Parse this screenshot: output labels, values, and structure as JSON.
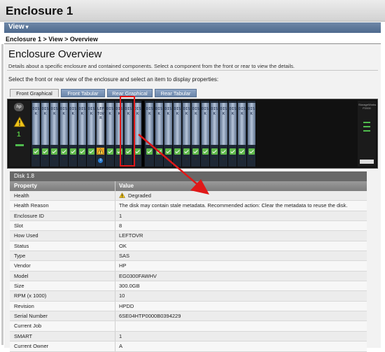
{
  "window": {
    "title": "Enclosure 1"
  },
  "menu": {
    "view_label": "View"
  },
  "breadcrumb": "Enclosure 1 > View > Overview",
  "page": {
    "heading": "Enclosure Overview",
    "description": "Details about a specific enclosure and contained components. Select a component from the front or rear to view the details.",
    "instruction": "Select the front or rear view of the enclosure and select an item to display properties:"
  },
  "tabs": [
    {
      "label": "Front Graphical",
      "active": true
    },
    {
      "label": "Front Tabular",
      "active": false
    },
    {
      "label": "Rear Graphical",
      "active": false
    },
    {
      "label": "Rear Tabular",
      "active": false
    }
  ],
  "enclosure": {
    "logo": "hp",
    "status_number": "1",
    "drive_label": "DISK",
    "selected_drive_label": "LEFTOVR",
    "right_brand": "StorageWorks P2000",
    "colors": {
      "drive_face": "#b6c5da",
      "ok_check": "#5fb84a",
      "warning": "#f0c419",
      "selection": "#e01818"
    }
  },
  "disk_panel": {
    "header": "Disk 1.8",
    "columns": [
      "Property",
      "Value"
    ],
    "rows": [
      {
        "property": "Health",
        "value": "Degraded",
        "icon": "warning-icon"
      },
      {
        "property": "Health Reason",
        "value": "The disk may contain stale metadata. Recommended action: Clear the metadata to reuse the disk."
      },
      {
        "property": "Enclosure ID",
        "value": "1"
      },
      {
        "property": "Slot",
        "value": "8"
      },
      {
        "property": "How Used",
        "value": "LEFTOVR"
      },
      {
        "property": "Status",
        "value": "OK"
      },
      {
        "property": "Type",
        "value": "SAS"
      },
      {
        "property": "Vendor",
        "value": "HP"
      },
      {
        "property": "Model",
        "value": "EG0300FAWHV"
      },
      {
        "property": "Size",
        "value": "300.0GB"
      },
      {
        "property": "RPM (x 1000)",
        "value": "10"
      },
      {
        "property": "Revision",
        "value": "HPDD"
      },
      {
        "property": "Serial Number",
        "value": "6SE04HTP0000B0394229"
      },
      {
        "property": "Current Job",
        "value": ""
      },
      {
        "property": "SMART",
        "value": "1"
      },
      {
        "property": "Current Owner",
        "value": "A"
      }
    ]
  }
}
